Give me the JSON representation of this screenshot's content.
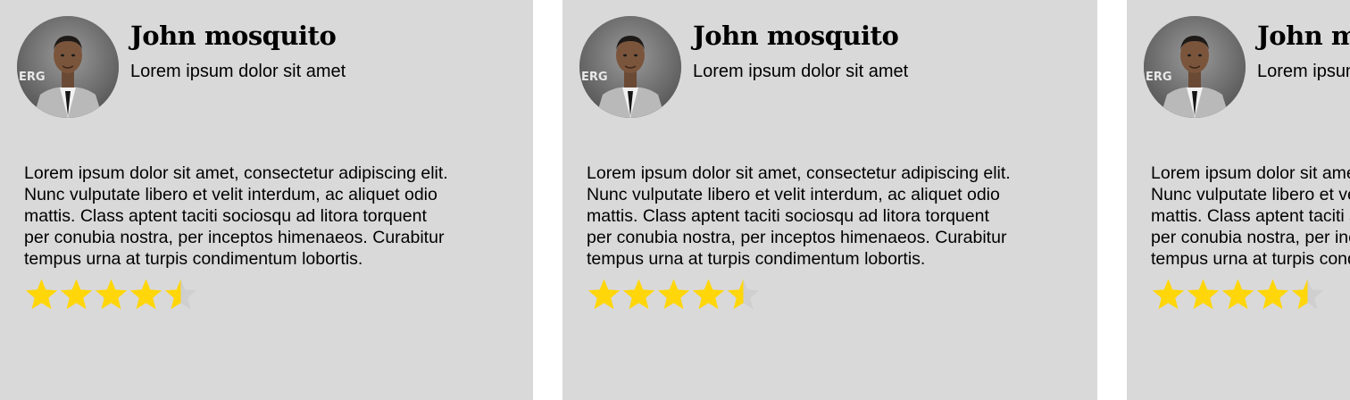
{
  "colors": {
    "card_background": "#d9d9d9",
    "star_filled": "#ffd60a",
    "star_empty": "#cfcfcf"
  },
  "cards": [
    {
      "name": "John mosquito",
      "subtitle": "Lorem ipsum dolor sit amet",
      "review_lines": [
        "Lorem ipsum dolor sit amet, consectetur adipiscing elit.",
        "Nunc vulputate libero et velit interdum, ac aliquet odio",
        "mattis. Class aptent taciti sociosqu ad litora torquent",
        "per conubia nostra, per inceptos himenaeos. Curabitur",
        "tempus urna at turpis condimentum lobortis."
      ],
      "rating": 4.5,
      "rating_max": 5,
      "avatar_icon": "person-photo"
    },
    {
      "name": "John mosquito",
      "subtitle": "Lorem ipsum dolor sit amet",
      "review_lines": [
        "Lorem ipsum dolor sit amet, consectetur adipiscing elit.",
        "Nunc vulputate libero et velit interdum, ac aliquet odio",
        "mattis. Class aptent taciti sociosqu ad litora torquent",
        "per conubia nostra, per inceptos himenaeos. Curabitur",
        "tempus urna at turpis condimentum lobortis."
      ],
      "rating": 4.5,
      "rating_max": 5,
      "avatar_icon": "person-photo"
    },
    {
      "name": "John mosquito",
      "subtitle": "Lorem ipsum dolor sit amet",
      "review_lines": [
        "Lorem ipsum dolor sit amet, consectetur adipiscing elit.",
        "Nunc vulputate libero et velit interdum, ac aliquet odio",
        "mattis. Class aptent taciti sociosqu ad litora torquent",
        "per conubia nostra, per inceptos himenaeos. Curabitur",
        "tempus urna at turpis condimentum lobortis."
      ],
      "rating": 4.5,
      "rating_max": 5,
      "avatar_icon": "person-photo"
    }
  ]
}
